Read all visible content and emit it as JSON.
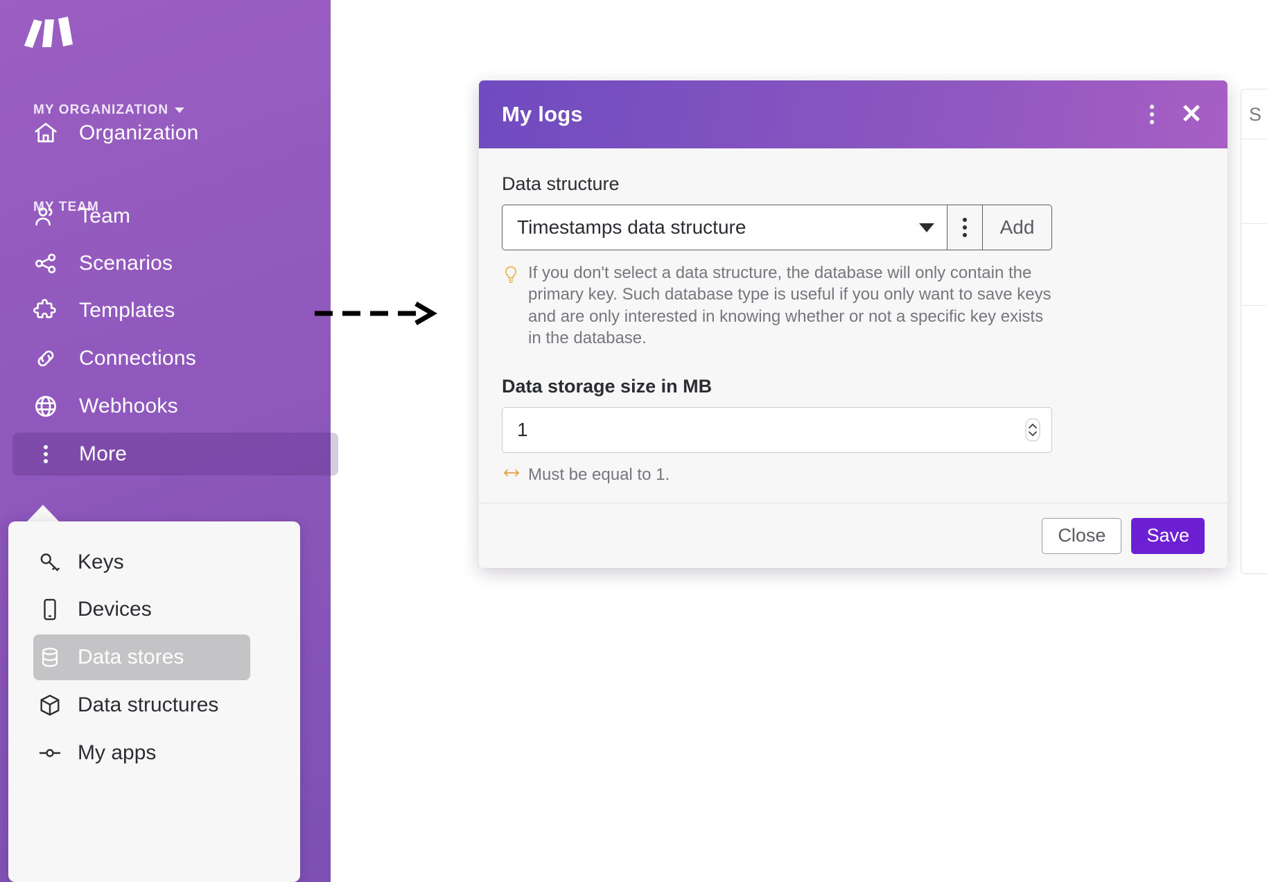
{
  "sidebar": {
    "logo_name": "make-logo",
    "org_section": {
      "label": "MY ORGANIZATION"
    },
    "org_item": {
      "label": "Organization",
      "icon": "home-icon"
    },
    "team_section": {
      "label": "MY TEAM"
    },
    "items": [
      {
        "label": "Team",
        "icon": "people-icon"
      },
      {
        "label": "Scenarios",
        "icon": "share-nodes-icon"
      },
      {
        "label": "Templates",
        "icon": "puzzle-piece-icon"
      },
      {
        "label": "Connections",
        "icon": "link-icon"
      },
      {
        "label": "Webhooks",
        "icon": "globe-icon"
      },
      {
        "label": "More",
        "icon": "kebab-icon"
      }
    ],
    "popover": {
      "items": [
        {
          "label": "Keys",
          "icon": "key-icon"
        },
        {
          "label": "Devices",
          "icon": "phone-icon"
        },
        {
          "label": "Data stores",
          "icon": "database-icon"
        },
        {
          "label": "Data structures",
          "icon": "cube-icon"
        },
        {
          "label": "My apps",
          "icon": "node-icon"
        }
      ]
    }
  },
  "annotation": {
    "name": "dashed-arrow"
  },
  "background_panel": {
    "title": "S"
  },
  "modal": {
    "title": "My logs",
    "kebab_icon": "kebab-icon",
    "close_icon": "close-icon",
    "data_structure": {
      "label": "Data structure",
      "selected": "Timestamps data structure",
      "caret_icon": "chevron-down-icon",
      "kebab_icon": "kebab-icon",
      "add_label": "Add",
      "hint_icon": "lightbulb-icon",
      "hint": "If you don't select a data structure, the database will only contain the primary key. Such database type is useful if you only want to save keys and are only interested in knowing whether or not a specific key exists in the database."
    },
    "storage": {
      "label": "Data storage size in MB",
      "value": "1",
      "spinner_icon": "stepper-icon",
      "validation_icon": "arrows-horizontal-icon",
      "validation": "Must be equal to 1."
    },
    "footer": {
      "close_label": "Close",
      "save_label": "Save"
    }
  },
  "colors": {
    "sidebar_purple": "#9159bd",
    "modal_header_start": "#6f4bc0",
    "modal_header_end": "#a75fc4",
    "save_purple": "#6d1fd4",
    "hint_yellow": "#e8a13a"
  }
}
